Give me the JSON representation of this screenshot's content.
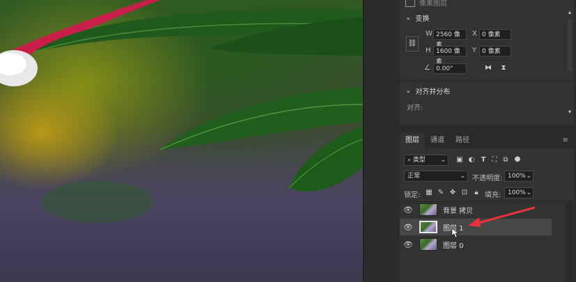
{
  "properties": {
    "top_fragment": "像素图层",
    "transform_title": "变换",
    "w_label": "W",
    "w_value": "2560 像素",
    "h_label": "H",
    "h_value": "1600 像素",
    "x_label": "X",
    "x_value": "0 像素",
    "y_label": "Y",
    "y_value": "0 像素",
    "angle_value": "0.00°",
    "align_title": "对齐并分布",
    "align_label": "对齐:"
  },
  "layers_panel": {
    "tabs": [
      "图层",
      "通道",
      "路径"
    ],
    "filter_kind": "类型",
    "blend_mode": "正常",
    "opacity_label": "不透明度:",
    "opacity_value": "100%",
    "lock_label": "锁定:",
    "fill_label": "填充:",
    "fill_value": "100%",
    "layers": [
      {
        "name": "背景 拷贝",
        "selected": false
      },
      {
        "name": "图层 1",
        "selected": true
      },
      {
        "name": "图层 0",
        "selected": false
      }
    ]
  },
  "colors": {
    "annotation_arrow": "#e8323c",
    "panel_bg": "#323232"
  }
}
